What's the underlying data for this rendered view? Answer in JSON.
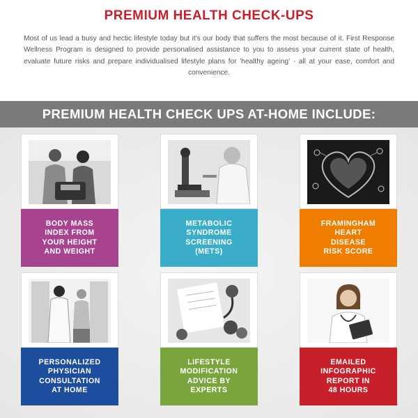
{
  "header": {
    "title": "PREMIUM HEALTH CHECK-UPS",
    "intro": "Most of us lead a busy and hectic lifestyle today but it's our body that suffers the most because of it. First Response Wellness Program is designed to provide personalised assistance to you to assess your current state of health, evaluate future risks and prepare individualised lifestyle plans for 'healthy ageing' - all at your ease, comfort and convenience."
  },
  "banner": {
    "text": "PREMIUM HEALTH CHECK UPS AT-HOME INCLUDE:"
  },
  "cards": [
    {
      "label": "BODY MASS\nINDEX FROM\nYOUR HEIGHT\nAND WEIGHT",
      "color": "#a8448f",
      "icon": "weighing-scale-icon"
    },
    {
      "label": "METABOLIC\nSYNDROME\nSCREENING\n(METS)",
      "color": "#3aaec8",
      "icon": "microscope-icon"
    },
    {
      "label": "FRAMINGHAM\nHEART\nDISEASE\nRISK SCORE",
      "color": "#ef7d00",
      "icon": "heart-icon"
    },
    {
      "label": "PERSONALIZED\nPHYSICIAN\nCONSULTATION\nAT HOME",
      "color": "#1c4e9d",
      "icon": "doctor-visit-icon"
    },
    {
      "label": "LIFESTYLE\nMODIFICATION\nADVICE BY\nEXPERTS",
      "color": "#7aa53d",
      "icon": "stethoscope-icon"
    },
    {
      "label": "EMAILED\nINFOGRAPHIC\nREPORT IN\n48 HOURS",
      "color": "#c8202a",
      "icon": "doctor-tablet-icon"
    }
  ],
  "colors": {
    "title": "#c8202a",
    "banner": "#7a7a7a",
    "text": "#555555"
  }
}
